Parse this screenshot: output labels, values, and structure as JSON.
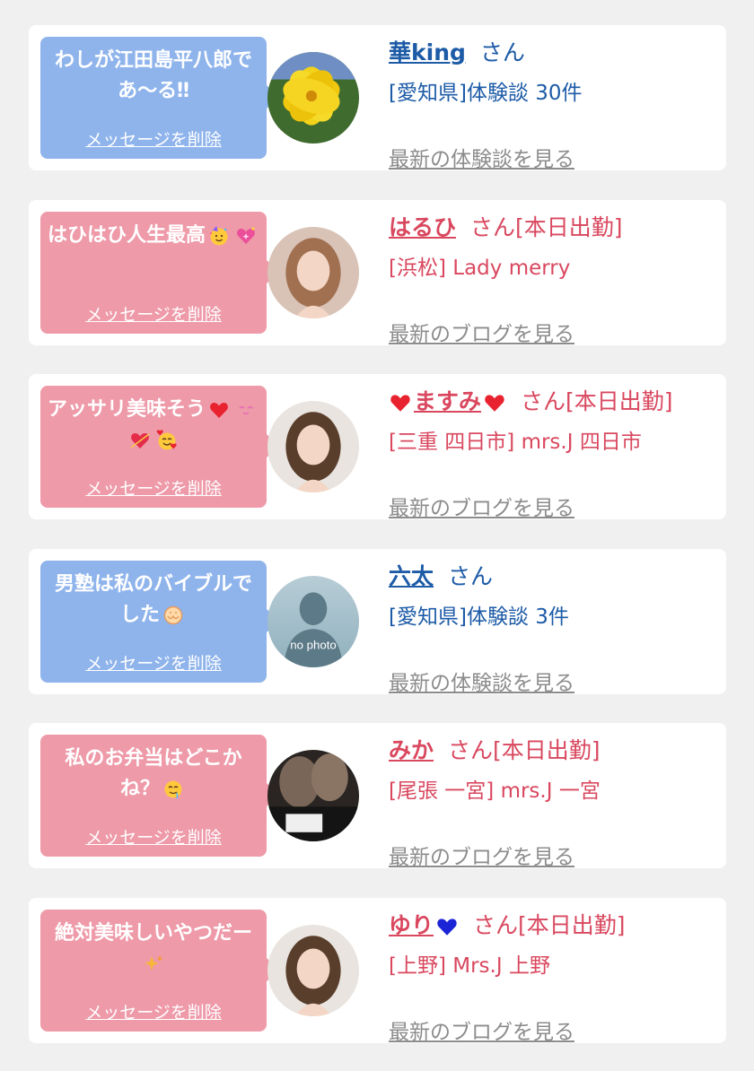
{
  "colors": {
    "bubble_blue": "#8fb4ec",
    "bubble_pink": "#ee9aa9",
    "name_blue": "#1d5ba7",
    "name_pink": "#d9485f",
    "link_gray": "#8c8c8c",
    "heart_red": "#e8232f",
    "heart_blue": "#1c25d6"
  },
  "messages": [
    {
      "theme": "blue",
      "message": "わしが江田島平八郎であ〜る‼",
      "message_icons": [],
      "delete_label": "メッセージを削除",
      "avatar_icon": "yellow-hibiscus-photo",
      "name": "華king",
      "name_icons_before": [],
      "name_icons_after": [],
      "suffix": "さん",
      "area": "[愛知県]体験談 30件",
      "view_label": "最新の体験談を見る"
    },
    {
      "theme": "pink",
      "message": "はひはひ人生最高",
      "message_icons": [
        "partying-face-emoji",
        "sparkling-heart-emoji"
      ],
      "delete_label": "メッセージを削除",
      "avatar_icon": "woman-portrait-photo",
      "name": "はるひ",
      "name_icons_before": [],
      "name_icons_after": [],
      "suffix": "さん[本日出勤]",
      "area": "[浜松] Lady merry",
      "view_label": "最新のブログを見る"
    },
    {
      "theme": "pink",
      "message": "アッサリ美味そう",
      "message_icons": [
        "red-heart-emoji",
        "smiling-eyes-emoji",
        "heart-with-arrow-emoji",
        "smiling-face-with-hearts-emoji"
      ],
      "delete_label": "メッセージを削除",
      "avatar_icon": "woman-portrait-photo",
      "name": "ますみ",
      "name_icons_before": [
        "red-heart-emoji"
      ],
      "name_icons_after": [
        "red-heart-emoji"
      ],
      "suffix": "さん[本日出勤]",
      "area": "[三重 四日市] mrs.J 四日市",
      "view_label": "最新のブログを見る"
    },
    {
      "theme": "blue",
      "message": "男塾は私のバイブルでした",
      "message_icons": [
        "open-hands-emoji"
      ],
      "delete_label": "メッセージを削除",
      "avatar_icon": "no-photo-silhouette",
      "avatar_text": "no photo",
      "name": "六太",
      "name_icons_before": [],
      "name_icons_after": [],
      "suffix": "さん",
      "area": "[愛知県]体験談 3件",
      "view_label": "最新の体験談を見る"
    },
    {
      "theme": "pink",
      "message": "私のお弁当はどこかね？",
      "message_icons": [
        "drooling-face-emoji"
      ],
      "delete_label": "メッセージを削除",
      "avatar_icon": "legs-dark-photo",
      "name": "みか",
      "name_icons_before": [],
      "name_icons_after": [],
      "suffix": "さん[本日出勤]",
      "area": "[尾張 一宮] mrs.J 一宮",
      "view_label": "最新のブログを見る"
    },
    {
      "theme": "pink",
      "message": "絶対美味しいやつだー",
      "message_icons": [
        "sparkles-emoji"
      ],
      "delete_label": "メッセージを削除",
      "avatar_icon": "woman-portrait-photo",
      "name": "ゆり",
      "name_icons_before": [],
      "name_icons_after": [
        "blue-heart-emoji"
      ],
      "suffix": "さん[本日出勤]",
      "area": "[上野] Mrs.J 上野",
      "view_label": "最新のブログを見る"
    }
  ]
}
